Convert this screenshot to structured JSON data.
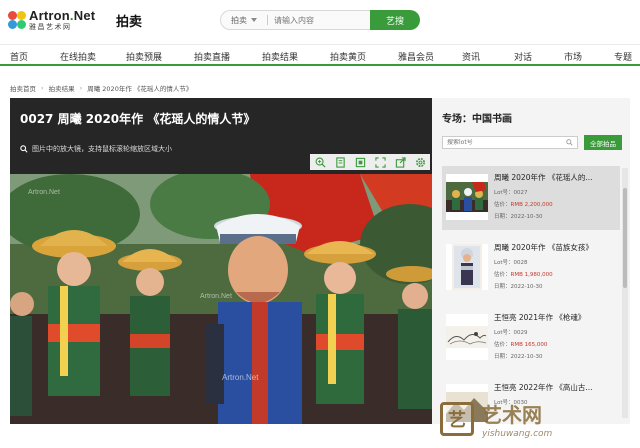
{
  "header": {
    "logo_en": "Artron",
    "logo_dot": ".",
    "logo_net": "Net",
    "logo_cn": "雅昌艺术网",
    "section": "拍卖",
    "search": {
      "category": "拍卖",
      "placeholder": "请输入内容",
      "button_label": "艺搜"
    }
  },
  "nav": {
    "items": [
      "首页",
      "在线拍卖",
      "拍卖预展",
      "拍卖直播",
      "拍卖结果",
      "拍卖黄页",
      "雅昌会员",
      "资讯",
      "对话",
      "市场",
      "专题"
    ]
  },
  "breadcrumb": [
    "拍卖首页",
    "拍卖结果",
    "周曦 2020年作 《花瑶人的情人节》"
  ],
  "viewer": {
    "title": "0027 周曦 2020年作 《花瑶人的情人节》",
    "tip": "图片中的放大镜，支持鼠标滚轮缩放区域大小",
    "tools": [
      "zoom-in-icon",
      "copy-icon",
      "fit-icon",
      "expand-icon",
      "share-icon",
      "settings-icon"
    ],
    "watermark": "Artron.Net"
  },
  "side": {
    "title": "专场：中国书画",
    "search_placeholder": "搜索lot号",
    "all_lots_label": "全部拍品",
    "lots": [
      {
        "name": "周曦 2020年作 《花瑶人的...",
        "lot": "Lot号：0027",
        "price_label": "估价：",
        "price": "RMB 2,200,000",
        "date": "日期：2022-10-30",
        "active": true
      },
      {
        "name": "周曦 2020年作 《苗族女孩》",
        "lot": "Lot号：0028",
        "price_label": "估价：",
        "price": "RMB 1,980,000",
        "date": "日期：2022-10-30",
        "active": false
      },
      {
        "name": "王恒亮 2021年作 《枪魂》",
        "lot": "Lot号：0029",
        "price_label": "估价：",
        "price": "RMB 165,000",
        "date": "日期：2022-10-30",
        "active": false
      },
      {
        "name": "王恒亮 2022年作 《高山古...",
        "lot": "Lot号：0030",
        "price_label": "",
        "price": "",
        "date": "",
        "active": false
      }
    ]
  },
  "watermark": {
    "seal": "艺",
    "main": "艺术网",
    "sub": "yishuwang.com"
  },
  "colors": {
    "brand_green": "#3a9b3a",
    "viewer_bg": "#262626",
    "price_red": "#c0392b"
  }
}
